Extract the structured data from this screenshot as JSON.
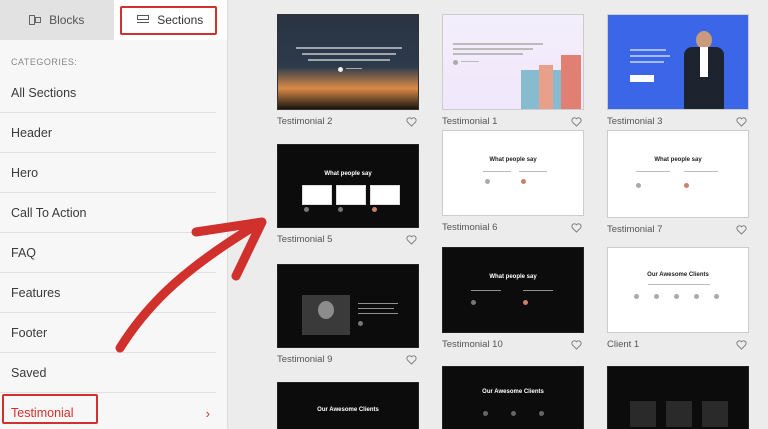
{
  "tabs": [
    {
      "label": "Blocks",
      "icon": "blocks-icon"
    },
    {
      "label": "Sections",
      "icon": "sections-icon"
    }
  ],
  "categories_label": "CATEGORIES:",
  "categories": [
    {
      "label": "All Sections"
    },
    {
      "label": "Header"
    },
    {
      "label": "Hero"
    },
    {
      "label": "Call To Action"
    },
    {
      "label": "FAQ"
    },
    {
      "label": "Features"
    },
    {
      "label": "Footer"
    },
    {
      "label": "Saved"
    },
    {
      "label": "Testimonial"
    }
  ],
  "cards": [
    {
      "label": "Testimonial 2"
    },
    {
      "label": "Testimonial 1"
    },
    {
      "label": "Testimonial 3"
    },
    {
      "label": "Testimonial 5",
      "heading": "What people say"
    },
    {
      "label": "Testimonial 6",
      "heading": "What people say"
    },
    {
      "label": "Testimonial 7",
      "heading": "What people say"
    },
    {
      "label": "Testimonial 9"
    },
    {
      "label": "Testimonial 10",
      "heading": "What people say"
    },
    {
      "label": "Client 1",
      "heading": "Our Awesome Clients"
    },
    {
      "label": "",
      "heading": "Our Awesome Clients"
    },
    {
      "label": "",
      "heading": "Our Awesome Clients"
    }
  ],
  "colors": {
    "accent": "#d0312d",
    "dark_thumb": "#0c0c0c"
  }
}
